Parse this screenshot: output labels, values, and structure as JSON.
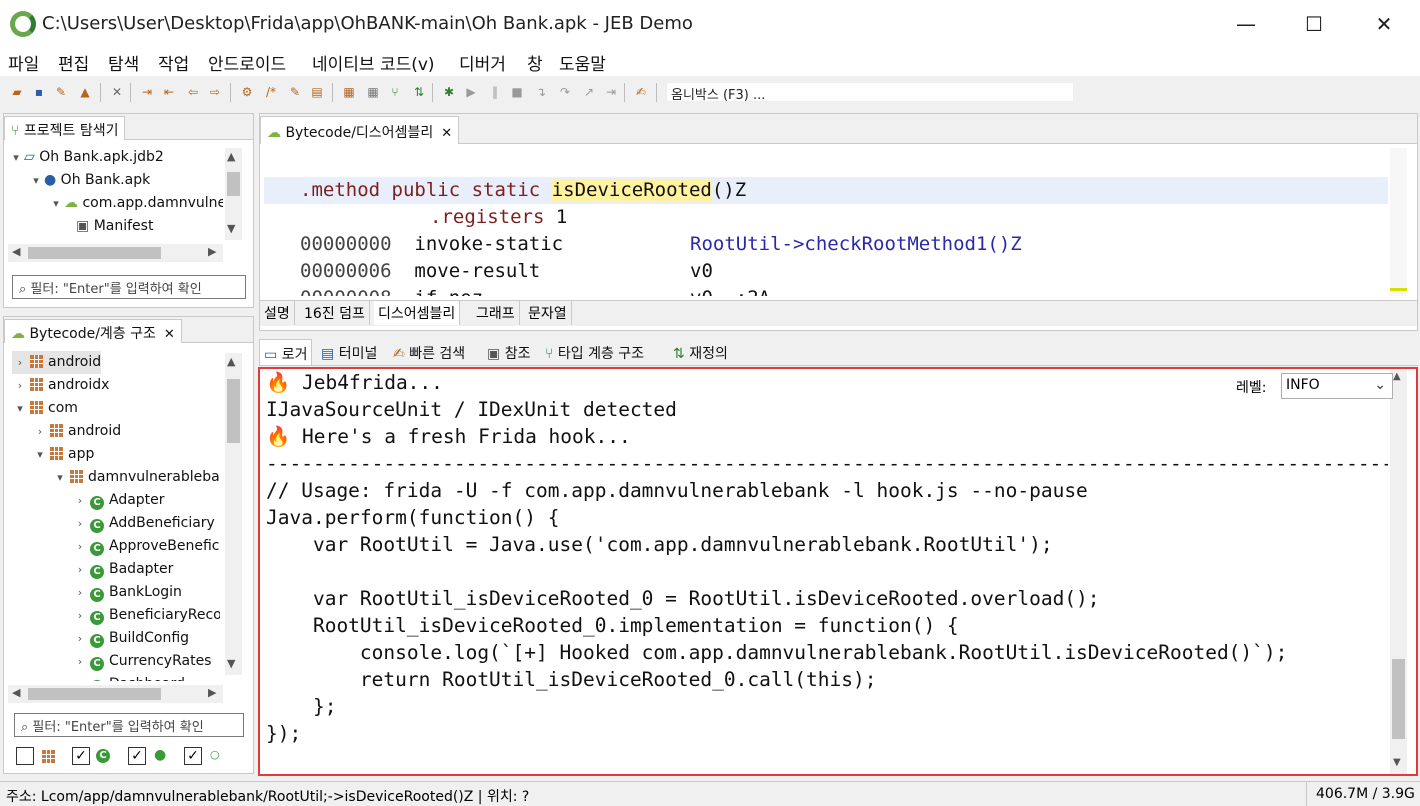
{
  "window": {
    "title": "C:\\Users\\User\\Desktop\\Frida\\app\\OhBANK-main\\Oh Bank.apk - JEB Demo",
    "minimize": "—",
    "maximize": "☐",
    "close": "✕"
  },
  "menu": [
    "파일",
    "편집",
    "탐색",
    "작업",
    "안드로이드",
    "네이티브 코드(v)",
    "디버거",
    "창",
    "도움말"
  ],
  "omnibox": {
    "placeholder": "옴니박스 (F3) ..."
  },
  "project_explorer": {
    "tab": "프로젝트 탐색기",
    "items": [
      {
        "label": "Oh Bank.apk.jdb2",
        "arrow": "▾"
      },
      {
        "label": "Oh Bank.apk",
        "arrow": "▾"
      },
      {
        "label": "com.app.damnvulnerablebank",
        "arrow": "▾"
      },
      {
        "label": "Manifest",
        "arrow": ""
      }
    ],
    "filter": "필터: \"Enter\"를 입력하여 확인"
  },
  "hierarchy": {
    "tab": "Bytecode/계층 구조",
    "items": [
      {
        "label": "android",
        "arrow": "›",
        "type": "pkg"
      },
      {
        "label": "androidx",
        "arrow": "›",
        "type": "pkg"
      },
      {
        "label": "com",
        "arrow": "▾",
        "type": "pkg"
      },
      {
        "label": "android",
        "arrow": "›",
        "type": "pkg"
      },
      {
        "label": "app",
        "arrow": "▾",
        "type": "pkg"
      },
      {
        "label": "damnvulnerablebank",
        "arrow": "▾",
        "type": "pkg"
      },
      {
        "label": "Adapter",
        "arrow": "›",
        "type": "cls"
      },
      {
        "label": "AddBeneficiary",
        "arrow": "›",
        "type": "cls"
      },
      {
        "label": "ApproveBeneficiary",
        "arrow": "›",
        "type": "cls"
      },
      {
        "label": "Badapter",
        "arrow": "›",
        "type": "cls"
      },
      {
        "label": "BankLogin",
        "arrow": "›",
        "type": "cls"
      },
      {
        "label": "BeneficiaryRecords",
        "arrow": "›",
        "type": "cls"
      },
      {
        "label": "BuildConfig",
        "arrow": "›",
        "type": "cls"
      },
      {
        "label": "CurrencyRates",
        "arrow": "›",
        "type": "cls"
      },
      {
        "label": "Dashboard",
        "arrow": "›",
        "type": "cls"
      }
    ],
    "filter": "필터: \"Enter\"를 입력하여 확인",
    "checkboxes": [
      "",
      "✓",
      "✓",
      "✓"
    ]
  },
  "editor": {
    "tab": "Bytecode/디스어셈블리",
    "lines": [
      {
        "a": ".method",
        "b": "public static",
        "c": "isDeviceRooted",
        "d": "()Z"
      },
      {
        "reg": ".registers",
        "n": "1"
      },
      {
        "addr": "00000000",
        "op": "invoke-static",
        "arg": "RootUtil->checkRootMethod1()Z"
      },
      {
        "addr": "00000006",
        "op": "move-result",
        "arg": "v0"
      },
      {
        "addr": "00000008",
        "op": "if-nez",
        "arg": "v0, :2A"
      }
    ],
    "bottom_tabs": [
      "설명",
      "16진 덤프",
      "디스어셈블리",
      "그래프",
      "문자열"
    ]
  },
  "console": {
    "tabs": [
      "로거",
      "터미널",
      "빠른 검색",
      "참조",
      "타입 계층 구조",
      "재정의"
    ],
    "level_label": "레벨:",
    "level_value": "INFO",
    "lines": [
      "🔥 Jeb4frida...",
      "IJavaSourceUnit / IDexUnit detected",
      "🔥 Here's a fresh Frida hook...",
      "------------------------------------------------------------------------------------------------------------------------",
      "// Usage: frida -U -f com.app.damnvulnerablebank -l hook.js --no-pause",
      "Java.perform(function() {",
      "    var RootUtil = Java.use('com.app.damnvulnerablebank.RootUtil');",
      "",
      "    var RootUtil_isDeviceRooted_0 = RootUtil.isDeviceRooted.overload();",
      "    RootUtil_isDeviceRooted_0.implementation = function() {",
      "        console.log(`[+] Hooked com.app.damnvulnerablebank.RootUtil.isDeviceRooted()`);",
      "        return RootUtil_isDeviceRooted_0.call(this);",
      "    };",
      "});"
    ]
  },
  "status": {
    "address": "주소: Lcom/app/damnvulnerablebank/RootUtil;->isDeviceRooted()Z | 위치: ?",
    "memory": "406.7M / 3.9G"
  }
}
